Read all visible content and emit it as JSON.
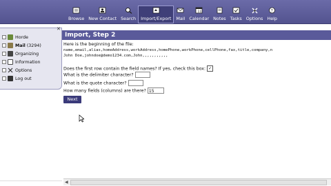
{
  "toolbar": {
    "items": [
      {
        "label": "Browse",
        "icon": "browse-icon"
      },
      {
        "label": "New Contact",
        "icon": "new-contact-icon"
      },
      {
        "label": "Search",
        "icon": "search-icon"
      },
      {
        "label": "Import/Export",
        "icon": "import-export-icon",
        "active": true
      },
      {
        "label": "Mail",
        "icon": "mail-icon"
      },
      {
        "label": "Calendar",
        "icon": "calendar-icon"
      },
      {
        "label": "Notes",
        "icon": "notes-icon"
      },
      {
        "label": "Tasks",
        "icon": "tasks-icon"
      },
      {
        "label": "Options",
        "icon": "options-icon"
      },
      {
        "label": "Help",
        "icon": "help-icon"
      }
    ]
  },
  "sidebar": {
    "items": [
      {
        "label": "Horde",
        "count": ""
      },
      {
        "label": "Mail",
        "count": "(3294)"
      },
      {
        "label": "Organizing",
        "count": ""
      },
      {
        "label": "Information",
        "count": ""
      },
      {
        "label": "Options",
        "count": ""
      },
      {
        "label": "Log out",
        "count": ""
      }
    ]
  },
  "main": {
    "title": "Import, Step 2",
    "intro": "Here is the beginning of the file:",
    "file_header": "name,email,alias,homeAddress,workAddress,homePhone,workPhone,cellPhone,fax,title,company,n",
    "file_row": "John Doe,johndoe@demo1234.com,John,,,,,,,,,,,",
    "first_row_question": "Does the first row contain the field names? If yes, check this box:",
    "first_row_checked": true,
    "delimiter_label": "What is the delimiter character?",
    "delimiter_value": "",
    "quote_label": "What is the quote character?",
    "quote_value": "",
    "fields_label": "How many fields (columns) are there?",
    "fields_value": "15",
    "next_label": "Next"
  },
  "colors": {
    "toolbar_bg": "#5d5d9a",
    "title_bar": "#5a5a9a",
    "button": "#3a3a7a",
    "sidebar_bg": "#e6e6f0"
  }
}
